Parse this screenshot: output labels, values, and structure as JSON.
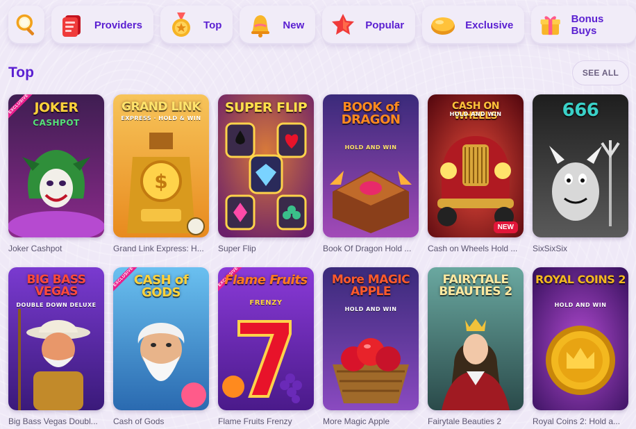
{
  "nav": {
    "categories": [
      {
        "label": "",
        "icon": "search-icon"
      },
      {
        "label": "Providers",
        "icon": "providers-icon"
      },
      {
        "label": "Top",
        "icon": "medal-icon"
      },
      {
        "label": "New",
        "icon": "bell-icon"
      },
      {
        "label": "Popular",
        "icon": "star-icon"
      },
      {
        "label": "Exclusive",
        "icon": "gem-icon"
      },
      {
        "label": "Bonus Buys",
        "icon": "gift-icon"
      }
    ]
  },
  "section": {
    "title": "Top",
    "see_all_label": "SEE ALL"
  },
  "games": [
    {
      "name": "Joker Cashpot",
      "art_title": "JOKER",
      "art_sub": "CASHPOT",
      "ribbon": "EXCLUSIVE",
      "colors": {
        "bg": "#7a2a7a",
        "accent": "#ffd23a"
      }
    },
    {
      "name": "Grand Link Express: H...",
      "art_title": "GRAND LINK",
      "art_sub": "EXPRESS · HOLD & WIN",
      "colors": {
        "bg": "#f4a23a",
        "accent": "#ffe36b"
      }
    },
    {
      "name": "Super Flip",
      "art_title": "SUPER FLIP",
      "colors": {
        "bg": "#a0388d",
        "accent": "#ffe04a"
      }
    },
    {
      "name": "Book Of Dragon Hold ...",
      "art_title": "BOOK of DRAGON",
      "art_sub": "HOLD AND WIN",
      "colors": {
        "bg": "#5b2f8f",
        "accent": "#ff8a1e"
      }
    },
    {
      "name": "Cash on Wheels Hold ...",
      "art_title": "CASH ON WHEELS",
      "art_sub": "HOLD AND WIN",
      "badge": "NEW",
      "colors": {
        "bg": "#a4151c",
        "accent": "#ffc23a"
      }
    },
    {
      "name": "SixSixSix",
      "art_title": "666",
      "colors": {
        "bg": "#2c2c2c",
        "accent": "#3ad1c8"
      }
    },
    {
      "name": "Big Bass Vegas Doubl...",
      "art_title": "BIG BASS VEGAS",
      "art_sub": "DOUBLE DOWN DELUXE",
      "colors": {
        "bg": "#6b2fa8",
        "accent": "#ff4a3a"
      }
    },
    {
      "name": "Cash of Gods",
      "art_title": "CASH of GODS",
      "ribbon": "EXCLUSIVE",
      "colors": {
        "bg": "#3f8fd6",
        "accent": "#ffd23a"
      }
    },
    {
      "name": "Flame Fruits Frenzy",
      "art_title": "Flame Fruits",
      "art_sub": "FRENZY",
      "ribbon": "EXCLUSIVE",
      "colors": {
        "bg": "#7a2db8",
        "accent": "#ff7a1e"
      }
    },
    {
      "name": "More Magic Apple",
      "art_title": "More MAGIC APPLE",
      "art_sub": "HOLD AND WIN",
      "colors": {
        "bg": "#4b2a86",
        "accent": "#ff5a2a"
      }
    },
    {
      "name": "Fairytale Beauties 2",
      "art_title": "FAIRYTALE BEAUTIES 2",
      "colors": {
        "bg": "#3a6f6a",
        "accent": "#ffe9a0"
      }
    },
    {
      "name": "Royal Coins 2: Hold a...",
      "art_title": "ROYAL COINS 2",
      "art_sub": "HOLD AND WIN",
      "colors": {
        "bg": "#6a2a8f",
        "accent": "#f3b81f"
      }
    }
  ]
}
